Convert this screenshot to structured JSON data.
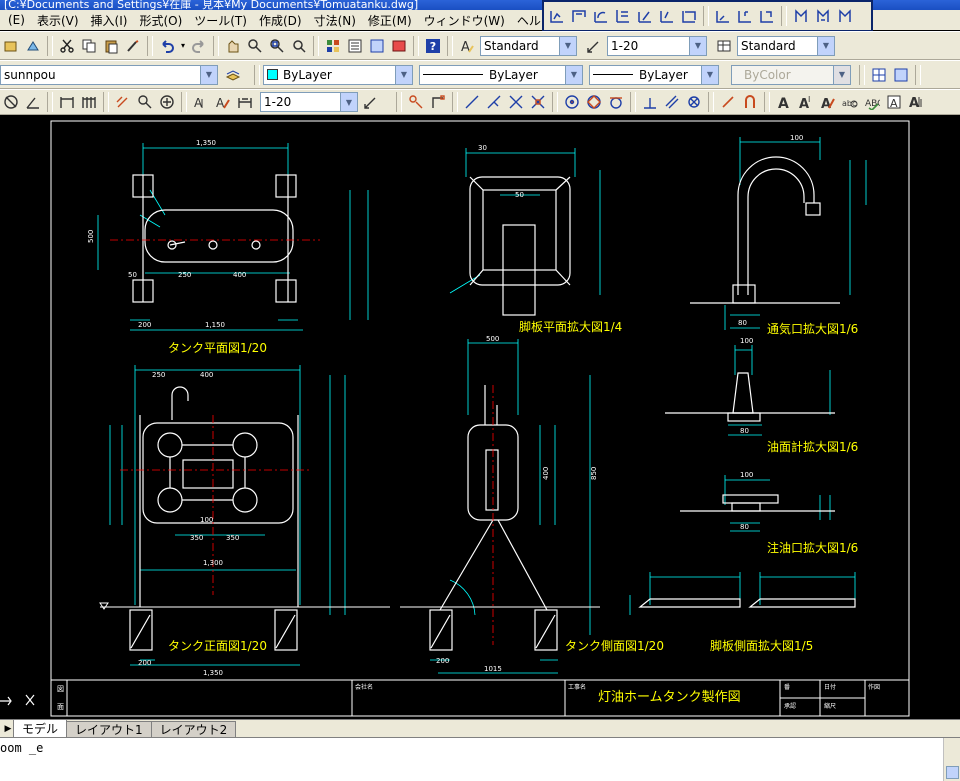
{
  "window": {
    "title": "[C:¥Documents and Settings¥在庫 - 見本¥My Documents¥Tomuatanku.dwg]"
  },
  "menu": [
    {
      "id": "edit",
      "label": "(E)"
    },
    {
      "id": "view",
      "label": "表示(V)"
    },
    {
      "id": "insert",
      "label": "挿入(I)"
    },
    {
      "id": "format",
      "label": "形式(O)"
    },
    {
      "id": "tools",
      "label": "ツール(T)"
    },
    {
      "id": "draw",
      "label": "作成(D)"
    },
    {
      "id": "dimension",
      "label": "寸法(N)"
    },
    {
      "id": "modify",
      "label": "修正(M)"
    },
    {
      "id": "window",
      "label": "ウィンドウ(W)"
    },
    {
      "id": "help",
      "label": "ヘルプ(H)"
    }
  ],
  "toolbar": {
    "text_style": "Standard",
    "dim_scale": "1-20",
    "table_style": "Standard",
    "layer": "sunnpou",
    "color": "ByLayer",
    "linetype": "ByLayer",
    "lineweight": "ByLayer",
    "plot_style": "ByColor",
    "dim_style2": "1-20"
  },
  "drawing": {
    "titles": {
      "tank_plan": "タンク平面図1/20",
      "tank_front": "タンク正面図1/20",
      "tank_side": "タンク側面図1/20",
      "footplate_plan": "脚板平面拡大図1/4",
      "footplate_side": "脚板側面拡大図1/5",
      "vent": "通気口拡大図1/6",
      "gauge": "油面計拡大図1/6",
      "inlet": "注油口拡大図1/6"
    },
    "dims": {
      "plan_top": "1,350",
      "plan_bottom": "1,150",
      "plan_mid_400": "400",
      "plan_mid_250": "250",
      "plan_50": "50",
      "plan_200": "200",
      "plan_500": "500",
      "front_1300": "1,300",
      "front_1350": "1,350",
      "front_350a": "350",
      "front_350b": "350",
      "front_400": "400",
      "front_250": "250",
      "front_100": "100",
      "front_200": "200",
      "side_500": "500",
      "side_1015": "1015",
      "side_200": "200",
      "side_400": "400",
      "side_850": "850",
      "fp_50": "50",
      "fp_30": "30",
      "vent_100": "100",
      "vent_80": "80",
      "gauge_100": "100",
      "gauge_80": "80",
      "inlet_100": "100",
      "inlet_80": "80"
    },
    "titleblock": {
      "work_label": "工事名",
      "work_title": "灯油ホームタンク製作図",
      "client_label": "会社名",
      "label_num": "番",
      "label_scale": "縮尺",
      "label_date": "日付",
      "label_check": "作図",
      "label_draw": "承認",
      "label_a": "図",
      "label_b": "面"
    }
  },
  "tabs": [
    {
      "id": "model",
      "label": "モデル",
      "active": true
    },
    {
      "id": "layout1",
      "label": "レイアウト1",
      "active": false
    },
    {
      "id": "layout2",
      "label": "レイアウト2",
      "active": false
    }
  ],
  "command": {
    "line1": "oom _e",
    "line2": ""
  },
  "colors": {
    "canvas_bg": "#000000",
    "dim_line": "#00ffff",
    "object_line": "#ffffff",
    "center_line": "#ff0000",
    "text_yellow": "#ffff00",
    "frame": "#ffffff"
  }
}
